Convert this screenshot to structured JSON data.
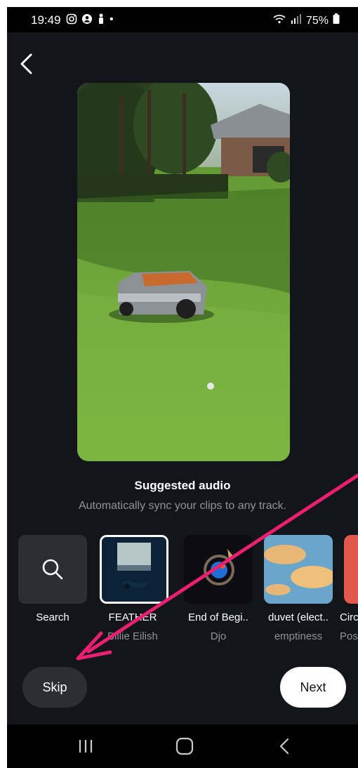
{
  "status_bar": {
    "time": "19:49",
    "icons": [
      "instagram-icon",
      "account-icon",
      "figure-icon"
    ],
    "dot": "•",
    "battery": "75%"
  },
  "preview": {
    "alt": "Video preview showing a robotic lawn mower on a green lawn"
  },
  "audio": {
    "title": "Suggested audio",
    "subtitle": "Automatically sync your clips to any track.",
    "tracks": [
      {
        "title": "Search",
        "artist": ""
      },
      {
        "title": "FEATHER",
        "artist": "Billie Eilish"
      },
      {
        "title": "End of Begi..",
        "artist": "Djo"
      },
      {
        "title": "duvet (elect..",
        "artist": "emptiness"
      },
      {
        "title": "Circ",
        "artist": "Pos"
      }
    ]
  },
  "buttons": {
    "skip": "Skip",
    "next": "Next"
  },
  "colors": {
    "background": "#13151b",
    "annotation_arrow": "#e8206f"
  }
}
